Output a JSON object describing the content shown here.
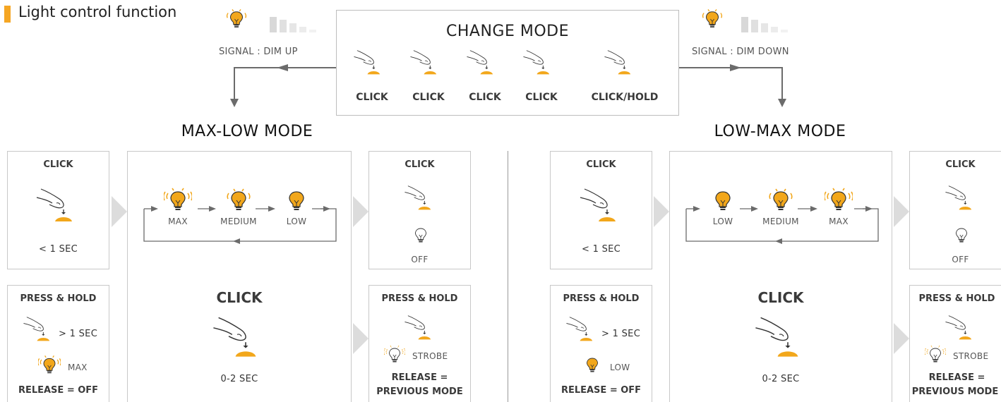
{
  "header": {
    "title": "Light control function"
  },
  "change_mode": {
    "title": "CHANGE MODE",
    "steps": [
      "CLICK",
      "CLICK",
      "CLICK",
      "CLICK",
      "CLICK/HOLD"
    ]
  },
  "signals": {
    "left": "SIGNAL : DIM UP",
    "right": "SIGNAL : DIM DOWN"
  },
  "max_low": {
    "title": "MAX-LOW MODE",
    "click_box": {
      "title": "CLICK",
      "duration": "< 1 SEC"
    },
    "hold_box": {
      "title": "PRESS & HOLD",
      "duration": "> 1 SEC",
      "level": "MAX",
      "release": "RELEASE = OFF"
    },
    "cycle": {
      "levels": [
        "MAX",
        "MEDIUM",
        "LOW"
      ],
      "click": "CLICK",
      "duration": "0-2 SEC"
    },
    "off_box": {
      "title": "CLICK",
      "state": "OFF"
    },
    "strobe_box": {
      "title": "PRESS & HOLD",
      "state": "STROBE",
      "release_line1": "RELEASE =",
      "release_line2": "PREVIOUS MODE"
    }
  },
  "low_max": {
    "title": "LOW-MAX MODE",
    "click_box": {
      "title": "CLICK",
      "duration": "< 1 SEC"
    },
    "hold_box": {
      "title": "PRESS & HOLD",
      "duration": "> 1 SEC",
      "level": "LOW",
      "release": "RELEASE = OFF"
    },
    "cycle": {
      "levels": [
        "LOW",
        "MEDIUM",
        "MAX"
      ],
      "click": "CLICK",
      "duration": "0-2 SEC"
    },
    "off_box": {
      "title": "CLICK",
      "state": "OFF"
    },
    "strobe_box": {
      "title": "PRESS & HOLD",
      "state": "STROBE",
      "release_line1": "RELEASE =",
      "release_line2": "PREVIOUS MODE"
    }
  },
  "colors": {
    "accent": "#f5a623",
    "bulb": "#f2a71b",
    "line": "#6b6b6b",
    "panel_border": "#c8c8c8",
    "chevron": "#dcdcdc"
  }
}
